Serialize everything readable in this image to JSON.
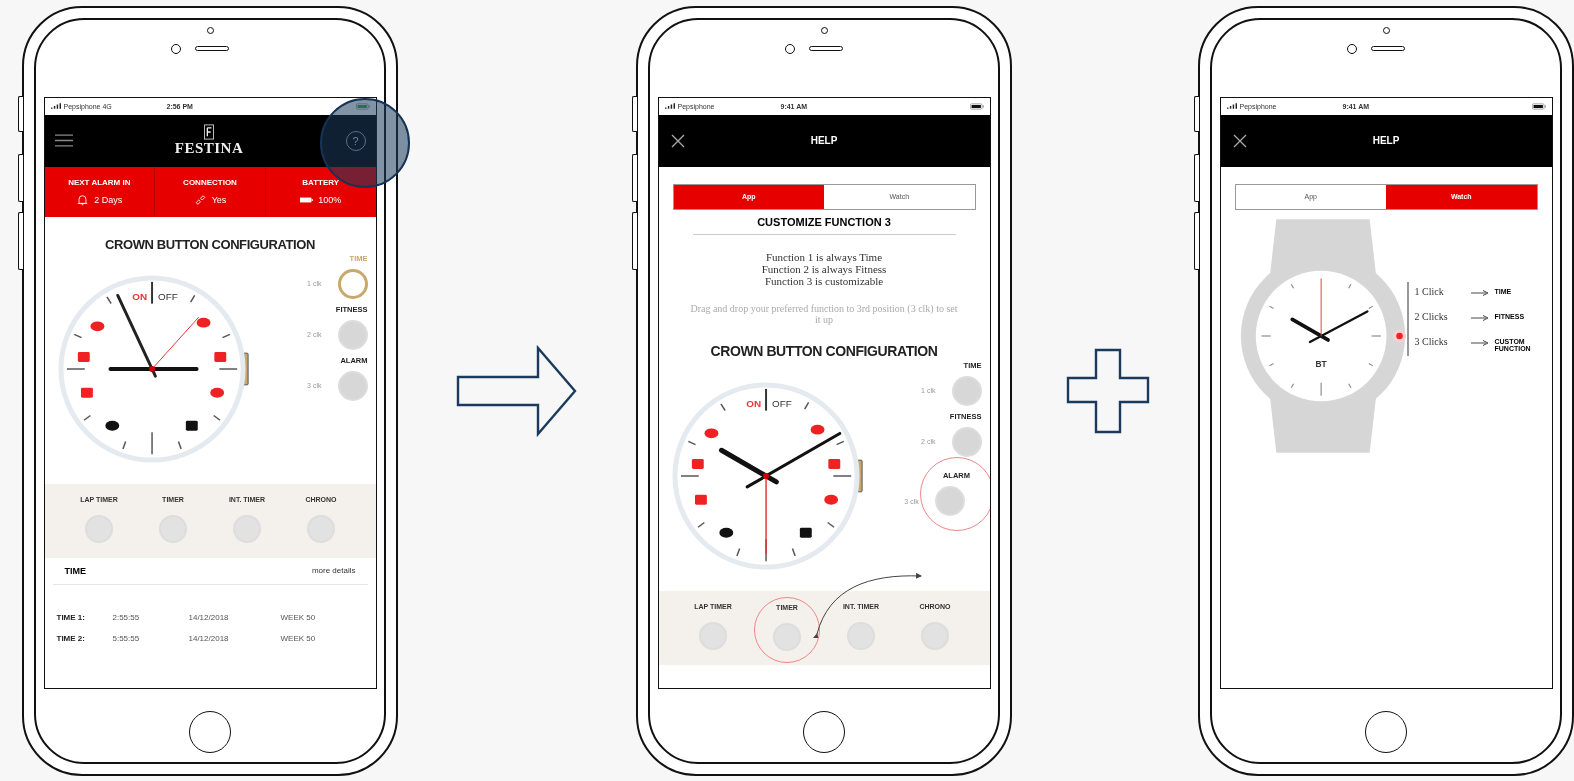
{
  "phones": [
    {
      "kind": "home",
      "status_bar": {
        "carrier": "Pepsiphone 4G",
        "time": "2:56 PM"
      },
      "header": {
        "logo": "FESTINA",
        "help_glyph": "?"
      },
      "help_highlight": true,
      "stats": [
        {
          "label": "NEXT ALARM IN",
          "value": "2 Days",
          "kind": "alarm"
        },
        {
          "label": "CONNECTION",
          "value": "Yes",
          "kind": "link"
        },
        {
          "label": "BATTERY",
          "value": "100%",
          "kind": "battery"
        }
      ],
      "title": "CROWN BUTTON CONFIGURATION",
      "dial": {
        "on_label": "ON",
        "off_label": "OFF"
      },
      "slots": [
        {
          "function": "TIME",
          "clicks": "1 clk",
          "selected": true,
          "highlighted": false
        },
        {
          "function": "FITNESS",
          "clicks": "2 clk",
          "selected": false,
          "highlighted": false
        },
        {
          "function": "ALARM",
          "clicks": "3 clk",
          "selected": false,
          "highlighted": false
        }
      ],
      "functions": [
        {
          "label": "LAP TIMER",
          "highlighted": false
        },
        {
          "label": "TIMER",
          "highlighted": false
        },
        {
          "label": "INT. TIMER",
          "highlighted": false
        },
        {
          "label": "CHRONO",
          "highlighted": false
        }
      ],
      "section": {
        "title": "TIME",
        "link": "more details"
      },
      "times": [
        {
          "label": "TIME 1:",
          "time": "2:55:55",
          "date": "14/12/2018",
          "week": "WEEK 50"
        },
        {
          "label": "TIME 2:",
          "time": "5:55:55",
          "date": "14/12/2018",
          "week": "WEEK 50"
        }
      ]
    },
    {
      "kind": "help_app",
      "status_bar": {
        "carrier": "Pepsiphone",
        "time": "9:41 AM"
      },
      "header": {
        "title": "HELP"
      },
      "tabs": [
        {
          "label": "App",
          "selected": true
        },
        {
          "label": "Watch",
          "selected": false
        }
      ],
      "subtitle": "CUSTOMIZE FUNCTION 3",
      "lines": [
        "Function 1 is always Time",
        "Function 2 is always Fitness",
        "Function 3 is customizable"
      ],
      "hint": "Drag and drop your preferred function to 3rd position (3 clk) to set it up",
      "title": "CROWN BUTTON CONFIGURATION",
      "dial": {
        "on_label": "ON",
        "off_label": "OFF"
      },
      "slots": [
        {
          "function": "TIME",
          "clicks": "1 clk",
          "selected": false,
          "highlighted": false
        },
        {
          "function": "FITNESS",
          "clicks": "2 clk",
          "selected": false,
          "highlighted": false
        },
        {
          "function": "ALARM",
          "clicks": "3 clk",
          "selected": false,
          "highlighted": true
        }
      ],
      "functions": [
        {
          "label": "LAP TIMER",
          "highlighted": false
        },
        {
          "label": "TIMER",
          "highlighted": true
        },
        {
          "label": "INT. TIMER",
          "highlighted": false
        },
        {
          "label": "CHRONO",
          "highlighted": false
        }
      ]
    },
    {
      "kind": "help_watch",
      "status_bar": {
        "carrier": "Pepsiphone",
        "time": "9:41 AM"
      },
      "header": {
        "title": "HELP"
      },
      "tabs": [
        {
          "label": "App",
          "selected": false
        },
        {
          "label": "Watch",
          "selected": true
        }
      ],
      "watch": {
        "label": "BT"
      },
      "clicks": [
        {
          "clicks": "1 Click",
          "function": "TIME"
        },
        {
          "clicks": "2 Clicks",
          "function": "FITNESS"
        },
        {
          "clicks": "3 Clicks",
          "function": "CUSTOM FUNCTION"
        }
      ]
    }
  ]
}
